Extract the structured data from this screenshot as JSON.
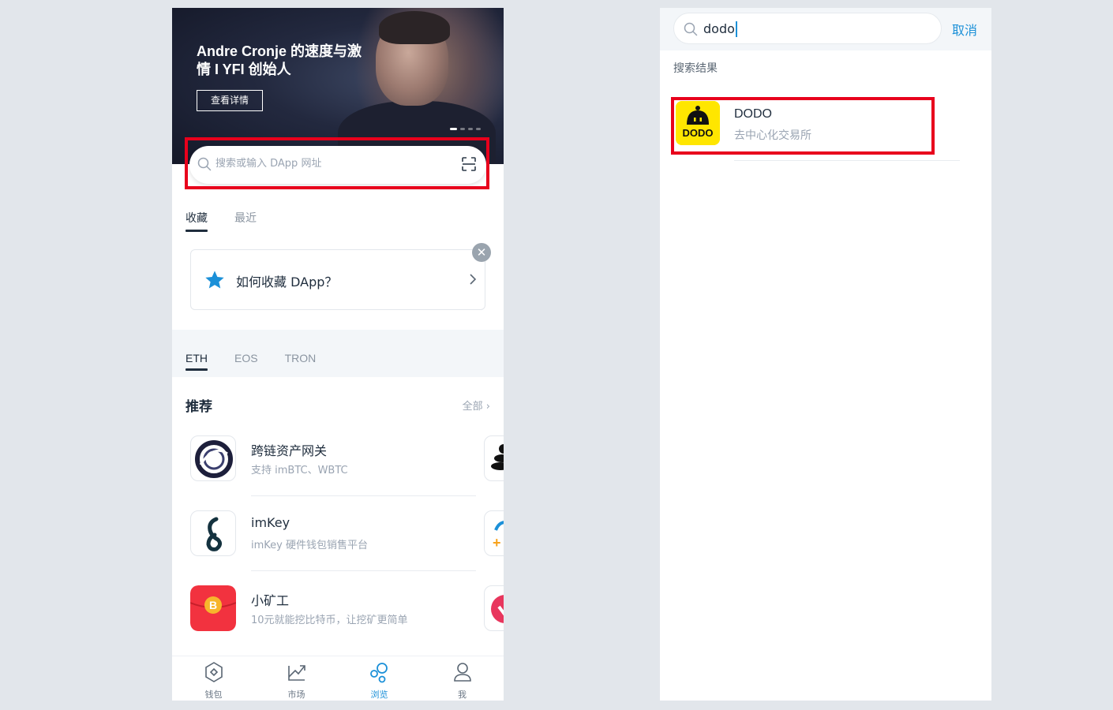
{
  "left": {
    "banner": {
      "title": "Andre Cronje 的速度与激情 I YFI 创始人",
      "button": "查看详情"
    },
    "search": {
      "placeholder": "搜索或输入 DApp 网址"
    },
    "tabs": [
      "收藏",
      "最近"
    ],
    "favorite_tip": {
      "text": "如何收藏 DApp？",
      "close": "✕"
    },
    "chains": [
      "ETH",
      "EOS",
      "TRON"
    ],
    "recommend": {
      "title": "推荐",
      "all": "全部 ›",
      "items": [
        {
          "name": "跨链资产网关",
          "desc": "支持 imBTC、WBTC",
          "icon": "cross-chain-gateway-icon"
        },
        {
          "name": "imKey",
          "desc": "imKey 硬件钱包销售平台",
          "icon": "imkey-icon"
        },
        {
          "name": "小矿工",
          "desc": "10元就能挖比特币，让挖矿更简单",
          "icon": "bitcoin-miner-icon"
        }
      ]
    },
    "bottom_nav": [
      {
        "label": "钱包",
        "icon": "wallet-icon",
        "active": false
      },
      {
        "label": "市场",
        "icon": "market-icon",
        "active": false
      },
      {
        "label": "浏览",
        "icon": "browse-icon",
        "active": true
      },
      {
        "label": "我",
        "icon": "profile-icon",
        "active": false
      }
    ]
  },
  "right": {
    "search": {
      "value": "dodo",
      "cancel": "取消"
    },
    "results_label": "搜索结果",
    "result": {
      "name": "DODO",
      "desc": "去中心化交易所",
      "icon_text": "DODO"
    }
  },
  "colors": {
    "accent": "#1b90d8",
    "highlight": "#e8001c",
    "dodo_yellow": "#ffe600"
  }
}
